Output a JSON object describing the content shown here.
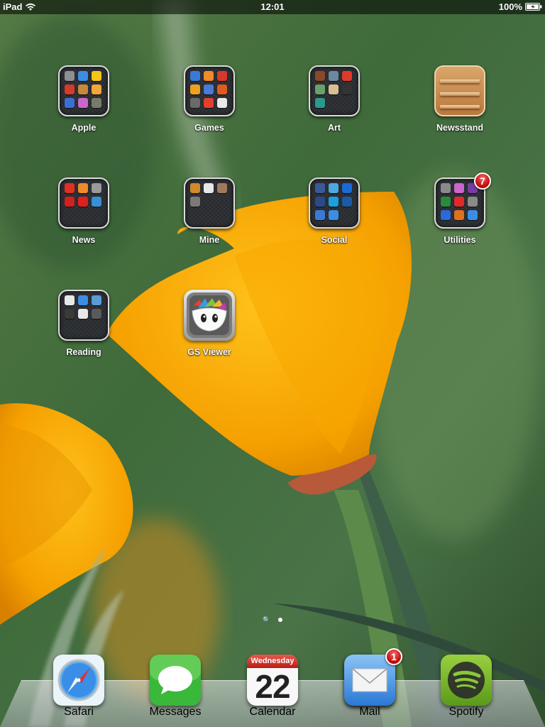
{
  "status_bar": {
    "device": "iPad",
    "time": "12:01",
    "battery": "100%"
  },
  "folders": [
    {
      "label": "Apple",
      "minis": [
        "#8e8e93",
        "#3a8ee6",
        "#f5c518",
        "#d33b2c",
        "#c48a3a",
        "#f2a53a",
        "#3a6fd6",
        "#cc66cc",
        "#7a7a6a"
      ]
    },
    {
      "label": "Games",
      "minis": [
        "#3a7ad6",
        "#f08a2a",
        "#d8382c",
        "#f0a020",
        "#4a7ad6",
        "#e05a20",
        "#6a6a6a",
        "#e04030",
        "#e8e8e8"
      ]
    },
    {
      "label": "Art",
      "minis": [
        "#8a4a2a",
        "#6a8aa0",
        "#e03a2a",
        "#6aa06a",
        "#d8c090",
        "#333333",
        "#2a9a8a"
      ]
    },
    {
      "label": "News",
      "minis": [
        "#e03020",
        "#f08a2a",
        "#9a9a9a",
        "#d02020",
        "#e02020",
        "#3a8ed6"
      ]
    },
    {
      "label": "Mine",
      "minis": [
        "#d08a2a",
        "#e8e8e8",
        "#a07a5a",
        "#7a7a7a"
      ]
    },
    {
      "label": "Social",
      "minis": [
        "#3b5998",
        "#4ea8e0",
        "#1a6ad6",
        "#2a4a8a",
        "#1aa0e0",
        "#1a5aa6",
        "#3a7ad6",
        "#3a8ee6"
      ]
    },
    {
      "label": "Utilities",
      "badge": "7",
      "minis": [
        "#8a8a8a",
        "#cc66cc",
        "#7a3aa6",
        "#2a8a3a",
        "#e02a2a",
        "#8a8a8a",
        "#2a6ad6",
        "#e07020",
        "#3a8ee6"
      ]
    },
    {
      "label": "Reading",
      "minis": [
        "#e8e8e8",
        "#3a8ee6",
        "#5a9ad6",
        "#3a3a3a",
        "#e8e8e8",
        "#5a5a5a"
      ]
    }
  ],
  "apps": {
    "newsstand": {
      "label": "Newsstand"
    },
    "gs_viewer": {
      "label": "GS Viewer"
    }
  },
  "dock": {
    "safari": {
      "label": "Safari"
    },
    "messages": {
      "label": "Messages"
    },
    "calendar": {
      "label": "Calendar",
      "weekday": "Wednesday",
      "day": "22"
    },
    "mail": {
      "label": "Mail",
      "badge": "1"
    },
    "spotify": {
      "label": "Spotify"
    }
  },
  "page_indicator": {
    "pages": 2,
    "current": 2
  }
}
